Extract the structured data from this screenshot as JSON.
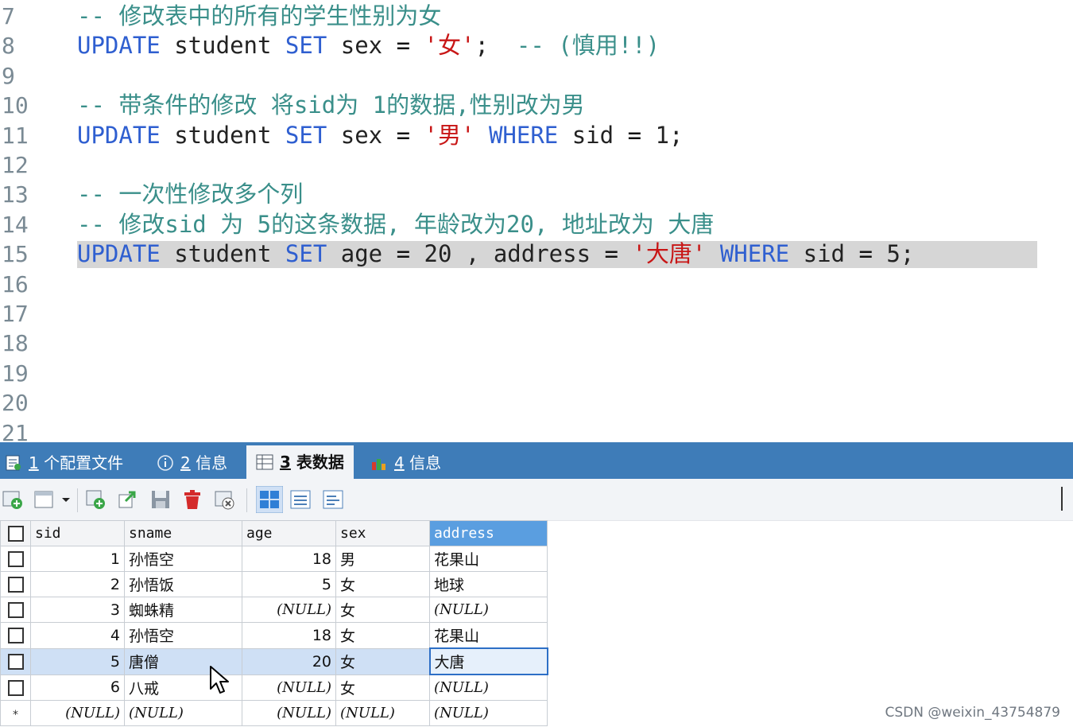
{
  "editor": {
    "lines": [
      {
        "n": "7",
        "tokens": [
          {
            "t": "-- 修改表中的所有的学生性别为女",
            "c": "cm"
          }
        ]
      },
      {
        "n": "8",
        "tokens": [
          {
            "t": "UPDATE",
            "c": "kw"
          },
          {
            "t": " student ",
            "c": ""
          },
          {
            "t": "SET",
            "c": "kw"
          },
          {
            "t": " sex ",
            "c": ""
          },
          {
            "t": "=",
            "c": "op"
          },
          {
            "t": " ",
            "c": ""
          },
          {
            "t": "'女'",
            "c": "str"
          },
          {
            "t": ";  ",
            "c": ""
          },
          {
            "t": "-- (慎用!!)",
            "c": "cm"
          }
        ]
      },
      {
        "n": "9",
        "tokens": []
      },
      {
        "n": "10",
        "tokens": [
          {
            "t": "-- 带条件的修改 将sid为 1的数据,性别改为男",
            "c": "cm"
          }
        ]
      },
      {
        "n": "11",
        "tokens": [
          {
            "t": "UPDATE",
            "c": "kw"
          },
          {
            "t": " student ",
            "c": ""
          },
          {
            "t": "SET",
            "c": "kw"
          },
          {
            "t": " sex ",
            "c": ""
          },
          {
            "t": "=",
            "c": "op"
          },
          {
            "t": " ",
            "c": ""
          },
          {
            "t": "'男'",
            "c": "str"
          },
          {
            "t": " ",
            "c": ""
          },
          {
            "t": "WHERE",
            "c": "kw"
          },
          {
            "t": " sid ",
            "c": ""
          },
          {
            "t": "=",
            "c": "op"
          },
          {
            "t": " 1;",
            "c": ""
          }
        ]
      },
      {
        "n": "12",
        "tokens": []
      },
      {
        "n": "13",
        "tokens": [
          {
            "t": "-- 一次性修改多个列",
            "c": "cm"
          }
        ]
      },
      {
        "n": "14",
        "tokens": [
          {
            "t": "-- 修改sid 为 5的这条数据, 年龄改为20, 地址改为 大唐",
            "c": "cm"
          }
        ]
      },
      {
        "n": "15",
        "highlight": true,
        "tokens": [
          {
            "t": "UPDATE",
            "c": "kw"
          },
          {
            "t": " student ",
            "c": ""
          },
          {
            "t": "SET",
            "c": "kw"
          },
          {
            "t": " age ",
            "c": ""
          },
          {
            "t": "=",
            "c": "op"
          },
          {
            "t": " 20 , address ",
            "c": ""
          },
          {
            "t": "=",
            "c": "op"
          },
          {
            "t": " ",
            "c": ""
          },
          {
            "t": "'大唐'",
            "c": "str"
          },
          {
            "t": " ",
            "c": ""
          },
          {
            "t": "WHERE",
            "c": "kw"
          },
          {
            "t": " sid ",
            "c": ""
          },
          {
            "t": "=",
            "c": "op"
          },
          {
            "t": " 5;",
            "c": ""
          }
        ]
      },
      {
        "n": "16",
        "tokens": []
      },
      {
        "n": "17",
        "tokens": []
      },
      {
        "n": "18",
        "tokens": []
      },
      {
        "n": "19",
        "tokens": []
      },
      {
        "n": "20",
        "tokens": []
      },
      {
        "n": "21",
        "tokens": []
      }
    ]
  },
  "tabs": [
    {
      "num": "1",
      "label": " 个配置文件",
      "icon": "profile-icon",
      "active": false
    },
    {
      "num": "2",
      "label": " 信息",
      "icon": "info-icon",
      "active": false
    },
    {
      "num": "3",
      "label": " 表数据",
      "icon": "table-icon",
      "active": true
    },
    {
      "num": "4",
      "label": " 信息",
      "icon": "chart-icon",
      "active": false
    }
  ],
  "toolbar": {
    "buttons": [
      "add-row-icon",
      "options-dropdown-icon",
      "duplicate-row-icon",
      "export-icon",
      "save-icon",
      "delete-icon",
      "cancel-icon",
      "grid-view-icon",
      "form-view-icon",
      "text-view-icon"
    ]
  },
  "grid": {
    "columns": [
      "sid",
      "sname",
      "age",
      "sex",
      "address"
    ],
    "selected_column": "address",
    "rows": [
      {
        "sid": "1",
        "sname": "孙悟空",
        "age": "18",
        "sex": "男",
        "address": "花果山"
      },
      {
        "sid": "2",
        "sname": "孙悟饭",
        "age": "5",
        "sex": "女",
        "address": "地球"
      },
      {
        "sid": "3",
        "sname": "蜘蛛精",
        "age": "(NULL)",
        "sex": "女",
        "address": "(NULL)"
      },
      {
        "sid": "4",
        "sname": "孙悟空",
        "age": "18",
        "sex": "女",
        "address": "花果山"
      },
      {
        "sid": "5",
        "sname": "唐僧",
        "age": "20",
        "sex": "女",
        "address": "大唐",
        "selected": true
      },
      {
        "sid": "6",
        "sname": "八戒",
        "age": "(NULL)",
        "sex": "女",
        "address": "(NULL)"
      },
      {
        "sid": "(NULL)",
        "sname": "(NULL)",
        "age": "(NULL)",
        "sex": "(NULL)",
        "address": "(NULL)",
        "new_row": true,
        "marker": "*"
      }
    ]
  },
  "watermark": "CSDN @weixin_43754879",
  "colors": {
    "tabbar": "#3e7cb8",
    "keyword": "#2f5fd0",
    "string": "#c81616",
    "comment": "#3a8f8a",
    "selection": "#cfe0f5"
  }
}
